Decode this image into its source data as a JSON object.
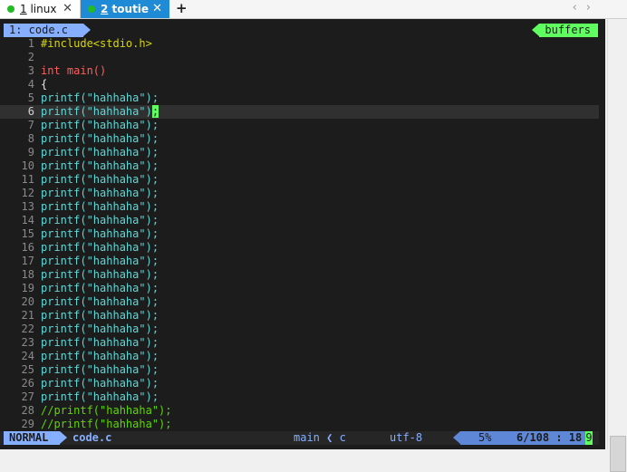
{
  "tabs": [
    {
      "num": "1",
      "name": "linux",
      "close": "✕"
    },
    {
      "num": "2",
      "name": "toutie",
      "close": "✕"
    }
  ],
  "tabbar": {
    "new_tab": "+",
    "nav_left": "‹",
    "nav_right": "›"
  },
  "bufferline": {
    "tab_label": "1: code.c",
    "right_label": "buffers"
  },
  "lines": [
    {
      "n": "1",
      "text": "#include<stdio.h>",
      "kind": "pre"
    },
    {
      "n": "2",
      "text": "",
      "kind": "plain"
    },
    {
      "n": "3",
      "text": "int main()",
      "kind": "kw"
    },
    {
      "n": "4",
      "text": "{",
      "kind": "plain"
    },
    {
      "n": "5",
      "text": "printf(\"hahhaha\");",
      "kind": "fn"
    },
    {
      "n": "6",
      "text": "printf(\"hahhaha\")",
      "kind": "fn",
      "current": true,
      "cursor_char": ";"
    },
    {
      "n": "7",
      "text": "printf(\"hahhaha\");",
      "kind": "fn"
    },
    {
      "n": "8",
      "text": "printf(\"hahhaha\");",
      "kind": "fn"
    },
    {
      "n": "9",
      "text": "printf(\"hahhaha\");",
      "kind": "fn"
    },
    {
      "n": "10",
      "text": "printf(\"hahhaha\");",
      "kind": "fn"
    },
    {
      "n": "11",
      "text": "printf(\"hahhaha\");",
      "kind": "fn"
    },
    {
      "n": "12",
      "text": "printf(\"hahhaha\");",
      "kind": "fn"
    },
    {
      "n": "13",
      "text": "printf(\"hahhaha\");",
      "kind": "fn"
    },
    {
      "n": "14",
      "text": "printf(\"hahhaha\");",
      "kind": "fn"
    },
    {
      "n": "15",
      "text": "printf(\"hahhaha\");",
      "kind": "fn"
    },
    {
      "n": "16",
      "text": "printf(\"hahhaha\");",
      "kind": "fn"
    },
    {
      "n": "17",
      "text": "printf(\"hahhaha\");",
      "kind": "fn"
    },
    {
      "n": "18",
      "text": "printf(\"hahhaha\");",
      "kind": "fn"
    },
    {
      "n": "19",
      "text": "printf(\"hahhaha\");",
      "kind": "fn"
    },
    {
      "n": "20",
      "text": "printf(\"hahhaha\");",
      "kind": "fn"
    },
    {
      "n": "21",
      "text": "printf(\"hahhaha\");",
      "kind": "fn"
    },
    {
      "n": "22",
      "text": "printf(\"hahhaha\");",
      "kind": "fn"
    },
    {
      "n": "23",
      "text": "printf(\"hahhaha\");",
      "kind": "fn"
    },
    {
      "n": "24",
      "text": "printf(\"hahhaha\");",
      "kind": "fn"
    },
    {
      "n": "25",
      "text": "printf(\"hahhaha\");",
      "kind": "fn"
    },
    {
      "n": "26",
      "text": "printf(\"hahhaha\");",
      "kind": "fn"
    },
    {
      "n": "27",
      "text": "printf(\"hahhaha\");",
      "kind": "fn"
    },
    {
      "n": "28",
      "text": "//printf(\"hahhaha\");",
      "kind": "cmt"
    },
    {
      "n": "29",
      "text": "//printf(\"hahhaha\");",
      "kind": "cmt"
    }
  ],
  "statusline": {
    "mode": "NORMAL",
    "file": "code.c",
    "func": "main ❮ c",
    "encoding": "utf-8",
    "percent": "5%",
    "position": "6/108 : 18",
    "col_tail": "9"
  },
  "colors": {
    "background": "#1c1c1c",
    "accent_blue": "#87afff",
    "accent_green": "#5fff5f",
    "tab_active": "#1f8ad6"
  }
}
